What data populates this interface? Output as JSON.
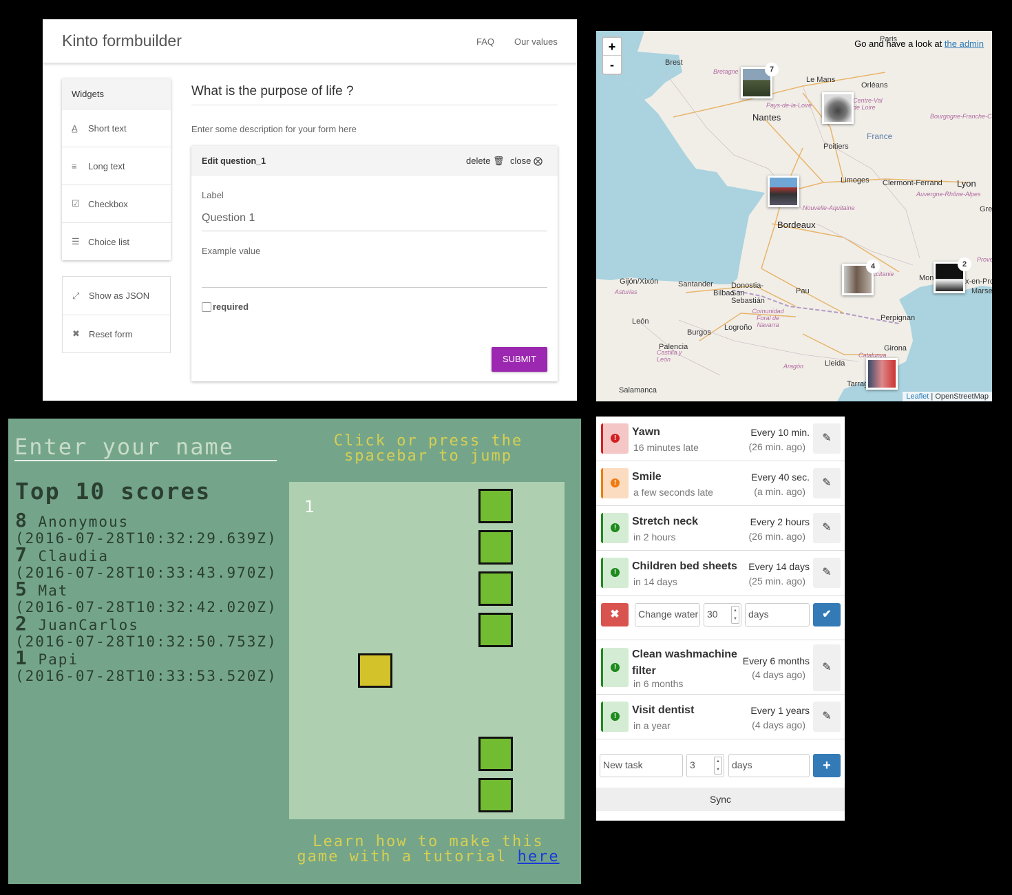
{
  "formbuilder": {
    "title": "Kinto formbuilder",
    "nav": [
      "FAQ",
      "Our values"
    ],
    "widgets_heading": "Widgets",
    "widgets": [
      {
        "icon": "text-icon",
        "label": "Short text"
      },
      {
        "icon": "paragraph-icon",
        "label": "Long text"
      },
      {
        "icon": "checkbox-icon",
        "label": "Checkbox"
      },
      {
        "icon": "list-icon",
        "label": "Choice list"
      }
    ],
    "actions": [
      {
        "icon": "fullscreen-icon",
        "label": "Show as JSON"
      },
      {
        "icon": "x-icon",
        "label": "Reset form"
      }
    ],
    "form_title": "What is the purpose of life ?",
    "form_description": "Enter some description for your form here",
    "edit": {
      "title": "Edit question_1",
      "delete": "delete",
      "close": "close",
      "label_caption": "Label",
      "label_value": "Question 1",
      "example_caption": "Example value",
      "example_value": "",
      "required": "required",
      "submit": "SUBMIT"
    }
  },
  "map": {
    "zoom_in": "+",
    "zoom_out": "-",
    "admin_text": "Go and have a look at",
    "admin_link": "the admin",
    "cities": [
      "Brest",
      "Le Mans",
      "Orléans",
      "Nantes",
      "Poitiers",
      "Limoges",
      "Clermont-Ferrand",
      "Lyon",
      "Bordeaux",
      "Gijón/Xixón",
      "Santander",
      "Bilbao",
      "Donostia-San Sebastián",
      "Pau",
      "Perpignan",
      "León",
      "Burgos",
      "Logroño",
      "Palencia",
      "Girona",
      "Lleida",
      "Tarragon",
      "Salamanca",
      "Marsei",
      "Paris",
      "Mont",
      "x-en-Pro",
      "Gre"
    ],
    "regions": [
      "Bretagne",
      "Pays-de-la-Loire",
      "Centre-Val de Loire",
      "Bourgogne-Franche-Co",
      "Nouvelle-Aquitaine",
      "Auvergne-Rhône-Alpes",
      "Occitanie",
      "Asturias",
      "Comunidad Foral de Navarra",
      "Castilla y León",
      "Aragón",
      "Catalunya",
      "Prove"
    ],
    "country": "France",
    "clusters": [
      {
        "count": "7"
      },
      {
        "count": "4"
      },
      {
        "count": "2"
      }
    ],
    "attribution_link": "Leaflet",
    "attribution_text": "| OpenStreetMap"
  },
  "game": {
    "name_placeholder": "Enter your name",
    "hint_line1": "Click or press the",
    "hint_line2": "spacebar to jump",
    "top_title": "Top 10 scores",
    "scores": [
      {
        "score": "8",
        "name": "Anonymous",
        "time": "(2016-07-28T10:32:29.639Z)"
      },
      {
        "score": "7",
        "name": "Claudia",
        "time": "(2016-07-28T10:33:43.970Z)"
      },
      {
        "score": "5",
        "name": "Mat",
        "time": "(2016-07-28T10:32:42.020Z)"
      },
      {
        "score": "2",
        "name": "JuanCarlos",
        "time": "(2016-07-28T10:32:50.753Z)"
      },
      {
        "score": "1",
        "name": "Papi",
        "time": "(2016-07-28T10:33:53.520Z)"
      }
    ],
    "current_score": "1",
    "learn_line1": "Learn how to make this",
    "learn_line2": "game with a tutorial",
    "learn_link": "here"
  },
  "tasks": {
    "items": [
      {
        "name": "Yawn",
        "late": "16 minutes late",
        "freq": "Every 10 min.",
        "ago": "(26 min. ago)",
        "status": "red"
      },
      {
        "name": "Smile",
        "late": "a few seconds late",
        "freq": "Every 40 sec.",
        "ago": "(a min. ago)",
        "status": "orange"
      },
      {
        "name": "Stretch neck",
        "late": "in 2 hours",
        "freq": "Every 2 hours",
        "ago": "(26 min. ago)",
        "status": "green"
      },
      {
        "name": "Children bed sheets",
        "late": "in 14 days",
        "freq": "Every 14 days",
        "ago": "(25 min. ago)",
        "status": "green"
      },
      {
        "name": "Clean washmachine filter",
        "late": "in 6 months",
        "freq": "Every 6 months",
        "ago": "(4 days ago)",
        "status": "green"
      },
      {
        "name": "Visit dentist",
        "late": "in a year",
        "freq": "Every 1 years",
        "ago": "(4 days ago)",
        "status": "green"
      }
    ],
    "edit_row": {
      "name": "Change water",
      "number": "30",
      "unit": "days"
    },
    "new_row": {
      "name": "New task",
      "number": "3",
      "unit": "days"
    },
    "sync": "Sync",
    "colors": {
      "red": "#d32020",
      "orange": "#f07b12",
      "green": "#1e8a1e",
      "primary": "#337ab7",
      "danger": "#d9534f"
    }
  }
}
